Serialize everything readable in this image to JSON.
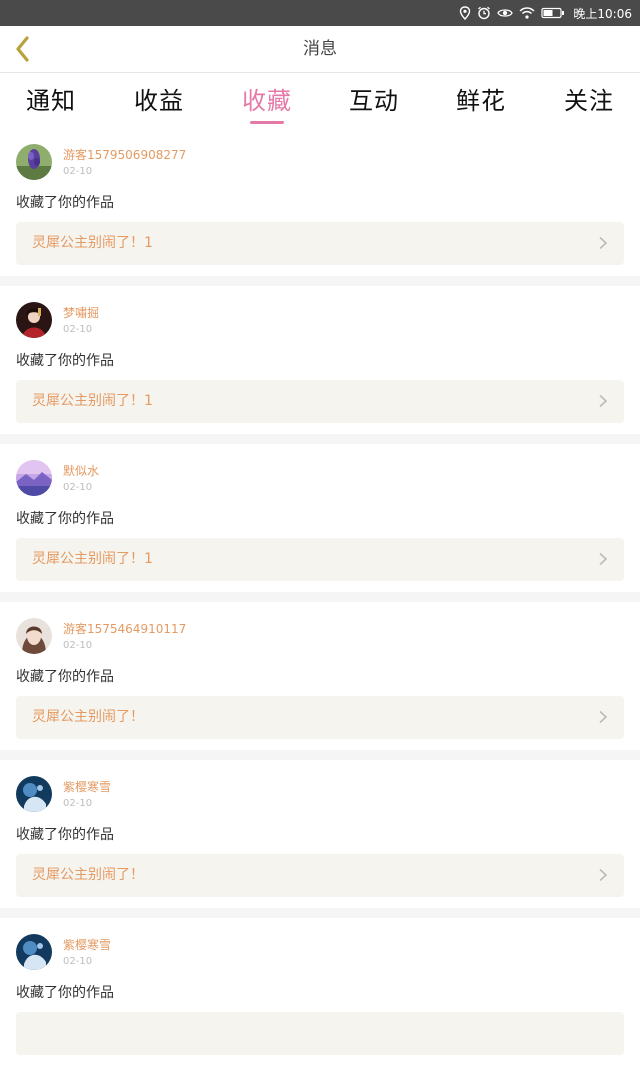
{
  "status_bar": {
    "time": "晚上10:06",
    "icons": [
      "location-icon",
      "alarm-icon",
      "eye-icon",
      "wifi-icon",
      "battery-icon"
    ]
  },
  "header": {
    "title": "消息"
  },
  "tabs": [
    {
      "label": "通知"
    },
    {
      "label": "收益"
    },
    {
      "label": "收藏"
    },
    {
      "label": "互动"
    },
    {
      "label": "鲜花"
    },
    {
      "label": "关注"
    }
  ],
  "active_tab": "收藏",
  "colors": {
    "accent": "#e57aa9",
    "username": "#e59a62",
    "work_bg": "#f5f4ef"
  },
  "messages": [
    {
      "user": "游客1579506908277",
      "date": "02-10",
      "action": "收藏了你的作品",
      "work": "灵犀公主别闹了！1",
      "avatar": "lavender-avatar"
    },
    {
      "user": "梦嘯掘",
      "date": "02-10",
      "action": "收藏了你的作品",
      "work": "灵犀公主别闹了！1",
      "avatar": "red-costume-avatar"
    },
    {
      "user": "默似水",
      "date": "02-10",
      "action": "收藏了你的作品",
      "work": "灵犀公主别闹了！1",
      "avatar": "purple-landscape-avatar"
    },
    {
      "user": "游客1575464910117",
      "date": "02-10",
      "action": "收藏了你的作品",
      "work": "灵犀公主别闹了！",
      "avatar": "girl-portrait-avatar"
    },
    {
      "user": "紫樱寒雪",
      "date": "02-10",
      "action": "收藏了你的作品",
      "work": "灵犀公主别闹了！",
      "avatar": "blue-art-avatar"
    },
    {
      "user": "紫樱寒雪",
      "date": "02-10",
      "action": "收藏了你的作品",
      "work": "",
      "avatar": "blue-art-avatar"
    }
  ]
}
